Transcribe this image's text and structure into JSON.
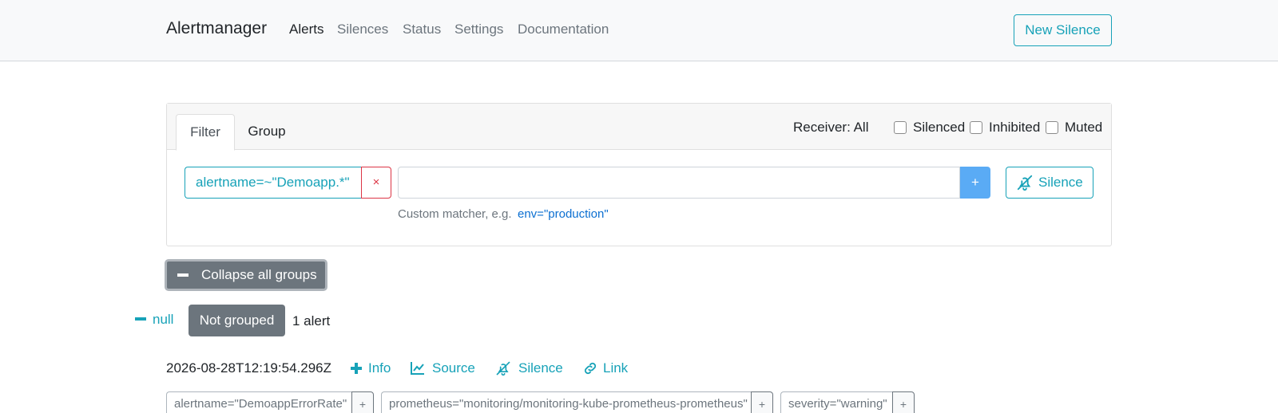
{
  "navbar": {
    "brand": "Alertmanager",
    "links": [
      "Alerts",
      "Silences",
      "Status",
      "Settings",
      "Documentation"
    ],
    "new_silence": "New Silence"
  },
  "filter_card": {
    "tabs": [
      "Filter",
      "Group"
    ],
    "receiver": "Receiver: All",
    "checkboxes": [
      {
        "label": "Silenced",
        "checked": false
      },
      {
        "label": "Inhibited",
        "checked": false
      },
      {
        "label": "Muted",
        "checked": false
      }
    ],
    "active_matcher": "alertname=~\"Demoapp.*\"",
    "remove_glyph": "×",
    "matcher_input_value": "",
    "add_glyph": "+",
    "silence_button": "Silence",
    "hint_text": "Custom matcher, e.g.",
    "hint_example": "env=\"production\""
  },
  "collapse_button": "Collapse all groups",
  "group": {
    "name": "null",
    "badge": "Not grouped",
    "count": "1 alert"
  },
  "alert": {
    "timestamp": "2026-08-28T12:19:54.296Z",
    "actions": [
      "Info",
      "Source",
      "Silence",
      "Link"
    ],
    "labels": [
      "alertname=\"DemoappErrorRate\"",
      "prometheus=\"monitoring/monitoring-kube-prometheus-prometheus\"",
      "severity=\"warning\""
    ],
    "label_add_glyph": "+"
  },
  "colors": {
    "accent": "#17a2b8",
    "danger": "#dc3545",
    "secondary": "#6c757d",
    "primary_light": "#5aabf5",
    "link": "#0b6fd1"
  }
}
